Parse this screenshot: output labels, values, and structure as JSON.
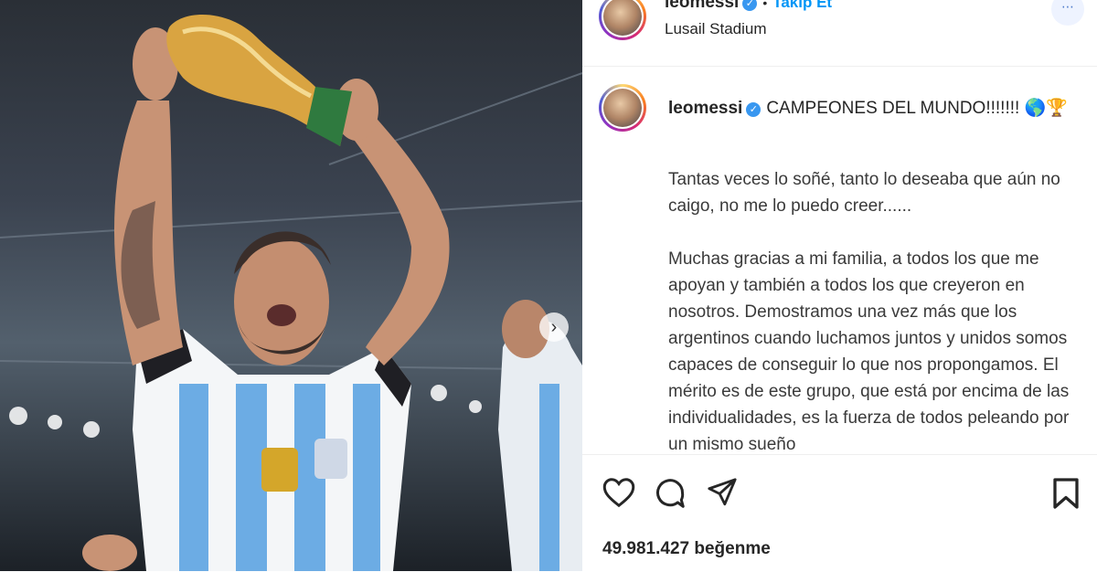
{
  "header": {
    "username": "leomessi",
    "follow_label": "Takip Et",
    "location": "Lusail Stadium"
  },
  "caption": {
    "username": "leomessi",
    "headline": "CAMPEONES DEL MUNDO!!!!!!! 🌎🏆",
    "paragraphs": [
      "Tantas veces lo soñé, tanto lo deseaba que aún no caigo, no me lo puedo creer......",
      "Muchas gracias a mi familia, a todos los que me apoyan y también a todos los que creyeron en nosotros. Demostramos una vez más que los argentinos cuando luchamos juntos y unidos somos capaces de conseguir lo que nos propongamos. El mérito es de este grupo, que está por encima de las individualidades, es la fuerza de todos peleando por un mismo sueño"
    ]
  },
  "actions": {
    "icons": [
      "heart-icon",
      "comment-icon",
      "share-icon",
      "bookmark-icon"
    ]
  },
  "likes_text": "49.981.427 beğenme",
  "colors": {
    "accent": "#0095f6",
    "verified": "#3897f0",
    "text": "#262626"
  }
}
